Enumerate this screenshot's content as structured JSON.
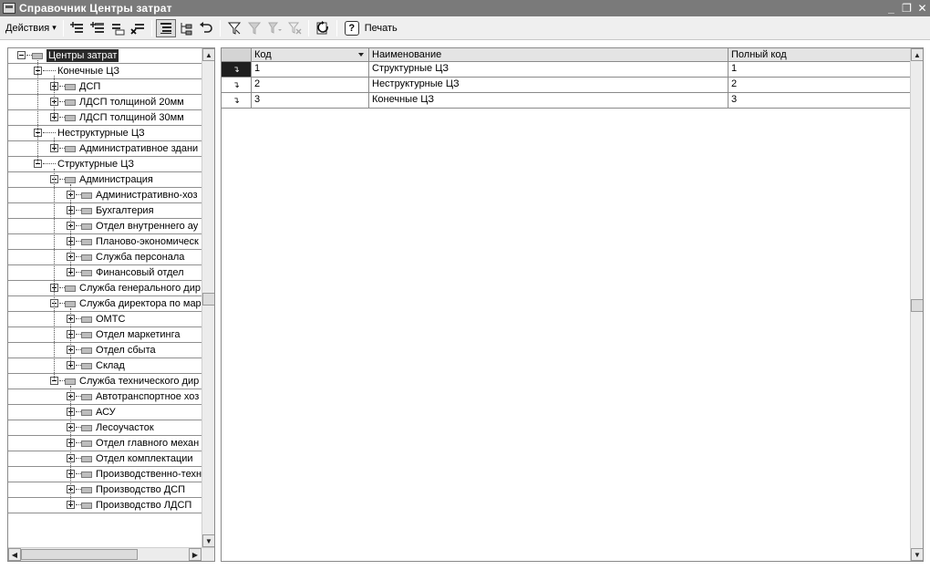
{
  "window": {
    "title": "Справочник Центры затрат",
    "buttons": {
      "minimize": "_",
      "restore": "❐",
      "close": "✕"
    }
  },
  "toolbar": {
    "actions_label": "Действия",
    "actions_arrow": "▾",
    "print_label": "Печать",
    "help_glyph": "?",
    "buttons": [
      "add-icon",
      "add-group-icon",
      "copy-icon",
      "delete-icon",
      "hierarchy-view-icon",
      "tree-view-icon",
      "back-icon",
      "filter-icon",
      "filter-list-icon",
      "filter-history-icon",
      "clear-filter-icon",
      "refresh-icon"
    ]
  },
  "tree": {
    "items": [
      {
        "label": "Центры затрат",
        "level": 0,
        "expander": "minus",
        "folder": true,
        "selected": true
      },
      {
        "label": "Конечные ЦЗ",
        "level": 1,
        "expander": "minus",
        "folder": false
      },
      {
        "label": "ДСП",
        "level": 2,
        "expander": "plus",
        "folder": true
      },
      {
        "label": "ЛДСП толщиной 20мм",
        "level": 2,
        "expander": "plus",
        "folder": true
      },
      {
        "label": "ЛДСП толщиной 30мм",
        "level": 2,
        "expander": "plus",
        "folder": true
      },
      {
        "label": "Неструктурные ЦЗ",
        "level": 1,
        "expander": "minus",
        "folder": false
      },
      {
        "label": "Административное здани",
        "level": 2,
        "expander": "plus",
        "folder": true
      },
      {
        "label": "Структурные ЦЗ",
        "level": 1,
        "expander": "minus",
        "folder": false
      },
      {
        "label": "Администрация",
        "level": 2,
        "expander": "minus",
        "folder": true
      },
      {
        "label": "Административно-хоз",
        "level": 3,
        "expander": "plus",
        "folder": true
      },
      {
        "label": "Бухгалтерия",
        "level": 3,
        "expander": "plus",
        "folder": true
      },
      {
        "label": "Отдел внутреннего ау",
        "level": 3,
        "expander": "plus",
        "folder": true
      },
      {
        "label": "Планово-экономическ",
        "level": 3,
        "expander": "plus",
        "folder": true
      },
      {
        "label": "Служба персонала",
        "level": 3,
        "expander": "plus",
        "folder": true
      },
      {
        "label": "Финансовый отдел",
        "level": 3,
        "expander": "plus",
        "folder": true
      },
      {
        "label": "Служба генерального дир",
        "level": 2,
        "expander": "plus",
        "folder": true
      },
      {
        "label": "Служба директора по мар",
        "level": 2,
        "expander": "minus",
        "folder": true
      },
      {
        "label": "ОМТС",
        "level": 3,
        "expander": "plus",
        "folder": true
      },
      {
        "label": "Отдел маркетинга",
        "level": 3,
        "expander": "plus",
        "folder": true
      },
      {
        "label": "Отдел сбыта",
        "level": 3,
        "expander": "plus",
        "folder": true
      },
      {
        "label": "Склад",
        "level": 3,
        "expander": "plus",
        "folder": true
      },
      {
        "label": "Служба технического дир",
        "level": 2,
        "expander": "minus",
        "folder": true
      },
      {
        "label": "Автотранспортное хоз",
        "level": 3,
        "expander": "plus",
        "folder": true
      },
      {
        "label": "АСУ",
        "level": 3,
        "expander": "plus",
        "folder": true
      },
      {
        "label": "Лесоучасток",
        "level": 3,
        "expander": "plus",
        "folder": true
      },
      {
        "label": "Отдел главного механ",
        "level": 3,
        "expander": "plus",
        "folder": true
      },
      {
        "label": "Отдел комплектации",
        "level": 3,
        "expander": "plus",
        "folder": true
      },
      {
        "label": "Производственно-техн",
        "level": 3,
        "expander": "plus",
        "folder": true
      },
      {
        "label": "Производство ДСП",
        "level": 3,
        "expander": "plus",
        "folder": true
      },
      {
        "label": "Производство ЛДСП",
        "level": 3,
        "expander": "plus",
        "folder": true
      }
    ]
  },
  "grid": {
    "columns": [
      "Код",
      "Наименование",
      "Полный код"
    ],
    "row_icon": "↴",
    "rows": [
      {
        "code": "1",
        "name": "Структурные ЦЗ",
        "full_code": "1",
        "current": true
      },
      {
        "code": "2",
        "name": "Неструктурные ЦЗ",
        "full_code": "2",
        "current": false
      },
      {
        "code": "3",
        "name": "Конечные ЦЗ",
        "full_code": "3",
        "current": false
      }
    ]
  },
  "scroll": {
    "up": "▲",
    "down": "▼",
    "left": "◀",
    "right": "▶"
  }
}
